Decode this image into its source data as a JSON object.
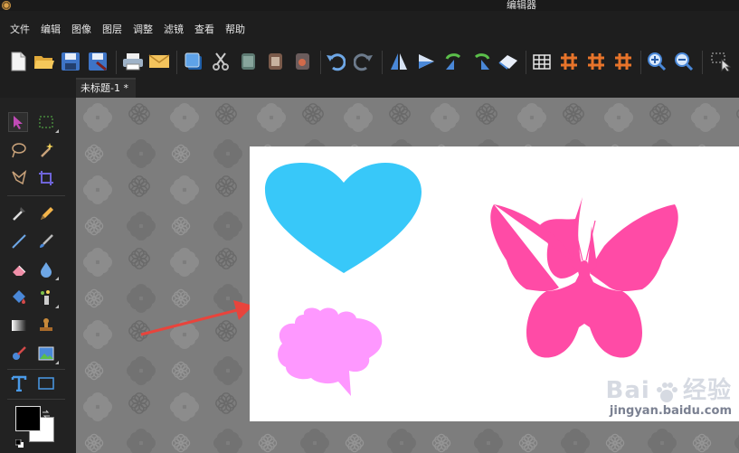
{
  "window": {
    "title": "编辑器"
  },
  "menu": [
    "文件",
    "编辑",
    "图像",
    "图层",
    "调整",
    "滤镜",
    "查看",
    "帮助"
  ],
  "toolbar": {
    "buttons": [
      "new-file",
      "open-folder",
      "save",
      "save-as",
      "print",
      "email",
      "layers",
      "cut",
      "copy",
      "paste",
      "delete",
      "undo",
      "redo",
      "flip-horizontal",
      "flip-vertical",
      "rotate-left",
      "rotate-right",
      "transform",
      "grid",
      "grid-hash",
      "grid-hash-2",
      "grid-hash-3",
      "zoom-in",
      "zoom-out",
      "select-tool"
    ]
  },
  "tabs": [
    {
      "label": "未标题-1 *"
    }
  ],
  "tools": [
    "pointer",
    "marquee",
    "lasso",
    "magic-wand",
    "polygon-lasso",
    "crop",
    "eyedropper",
    "pencil",
    "line",
    "brush",
    "eraser",
    "blur-drop",
    "paint-bucket",
    "spray",
    "gradient",
    "stamp",
    "color-replace",
    "image-tool",
    "text",
    "rectangle"
  ],
  "colors": {
    "foreground": "#000000",
    "background": "#ffffff",
    "heart": "#38c8f9",
    "butterfly": "#ff4ba6",
    "bubble": "#fe98ff",
    "arrow": "#e8443c"
  },
  "watermark": {
    "brand": "Bai",
    "brand_suffix": "经验",
    "url": "jingyan.baidu.com"
  }
}
